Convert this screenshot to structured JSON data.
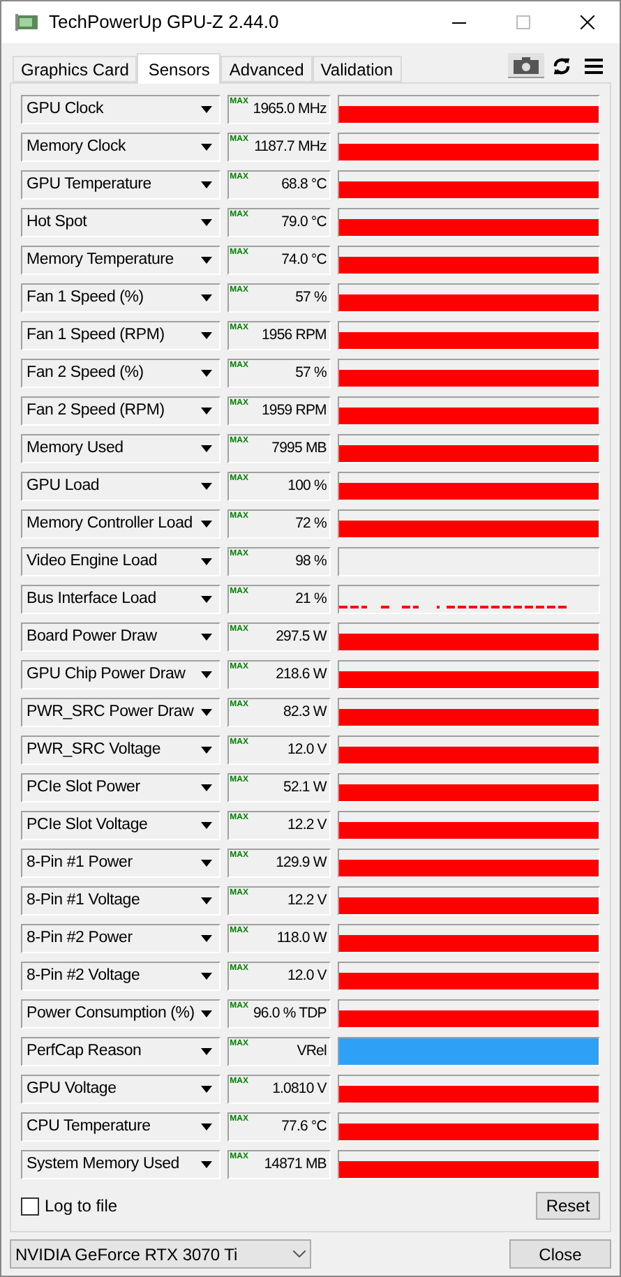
{
  "window": {
    "title": "TechPowerUp GPU-Z 2.44.0"
  },
  "tabs": [
    {
      "label": "Graphics Card",
      "selected": false
    },
    {
      "label": "Sensors",
      "selected": true
    },
    {
      "label": "Advanced",
      "selected": false
    },
    {
      "label": "Validation",
      "selected": false
    }
  ],
  "sensors": [
    {
      "name": "GPU Clock",
      "max_label": "MAX",
      "value": "1965.0 MHz",
      "kind": "filled"
    },
    {
      "name": "Memory Clock",
      "max_label": "MAX",
      "value": "1187.7 MHz",
      "kind": "filled"
    },
    {
      "name": "GPU Temperature",
      "max_label": "MAX",
      "value": "68.8 °C",
      "kind": "filled"
    },
    {
      "name": "Hot Spot",
      "max_label": "MAX",
      "value": "79.0 °C",
      "kind": "filled"
    },
    {
      "name": "Memory Temperature",
      "max_label": "MAX",
      "value": "74.0 °C",
      "kind": "filled"
    },
    {
      "name": "Fan 1 Speed (%)",
      "max_label": "MAX",
      "value": "57 %",
      "kind": "filled"
    },
    {
      "name": "Fan 1 Speed (RPM)",
      "max_label": "MAX",
      "value": "1956 RPM",
      "kind": "filled"
    },
    {
      "name": "Fan 2 Speed (%)",
      "max_label": "MAX",
      "value": "57 %",
      "kind": "filled"
    },
    {
      "name": "Fan 2 Speed (RPM)",
      "max_label": "MAX",
      "value": "1959 RPM",
      "kind": "filled"
    },
    {
      "name": "Memory Used",
      "max_label": "MAX",
      "value": "7995 MB",
      "kind": "filled"
    },
    {
      "name": "GPU Load",
      "max_label": "MAX",
      "value": "100 %",
      "kind": "filled"
    },
    {
      "name": "Memory Controller Load",
      "max_label": "MAX",
      "value": "72 %",
      "kind": "filled"
    },
    {
      "name": "Video Engine Load",
      "max_label": "MAX",
      "value": "98 %",
      "kind": "empty"
    },
    {
      "name": "Bus Interface Load",
      "max_label": "MAX",
      "value": "21 %",
      "kind": "sparse"
    },
    {
      "name": "Board Power Draw",
      "max_label": "MAX",
      "value": "297.5 W",
      "kind": "filled"
    },
    {
      "name": "GPU Chip Power Draw",
      "max_label": "MAX",
      "value": "218.6 W",
      "kind": "filled"
    },
    {
      "name": "PWR_SRC Power Draw",
      "max_label": "MAX",
      "value": "82.3 W",
      "kind": "filled"
    },
    {
      "name": "PWR_SRC Voltage",
      "max_label": "MAX",
      "value": "12.0 V",
      "kind": "filled"
    },
    {
      "name": "PCIe Slot Power",
      "max_label": "MAX",
      "value": "52.1 W",
      "kind": "filled"
    },
    {
      "name": "PCIe Slot Voltage",
      "max_label": "MAX",
      "value": "12.2 V",
      "kind": "filled"
    },
    {
      "name": "8-Pin #1 Power",
      "max_label": "MAX",
      "value": "129.9 W",
      "kind": "filled"
    },
    {
      "name": "8-Pin #1 Voltage",
      "max_label": "MAX",
      "value": "12.2 V",
      "kind": "filled"
    },
    {
      "name": "8-Pin #2 Power",
      "max_label": "MAX",
      "value": "118.0 W",
      "kind": "filled"
    },
    {
      "name": "8-Pin #2 Voltage",
      "max_label": "MAX",
      "value": "12.0 V",
      "kind": "filled"
    },
    {
      "name": "Power Consumption (%)",
      "max_label": "MAX",
      "value": "96.0 % TDP",
      "kind": "filled"
    },
    {
      "name": "PerfCap Reason",
      "max_label": "MAX",
      "value": "VRel",
      "kind": "state"
    },
    {
      "name": "GPU Voltage",
      "max_label": "MAX",
      "value": "1.0810 V",
      "kind": "filled"
    },
    {
      "name": "CPU Temperature",
      "max_label": "MAX",
      "value": "77.6 °C",
      "kind": "filled"
    },
    {
      "name": "System Memory Used",
      "max_label": "MAX",
      "value": "14871 MB",
      "kind": "filled"
    }
  ],
  "log_to_file": {
    "label": "Log to file",
    "checked": false
  },
  "reset_button": "Reset",
  "gpu_select": {
    "value": "NVIDIA GeForce RTX 3070 Ti"
  },
  "close_button": "Close"
}
